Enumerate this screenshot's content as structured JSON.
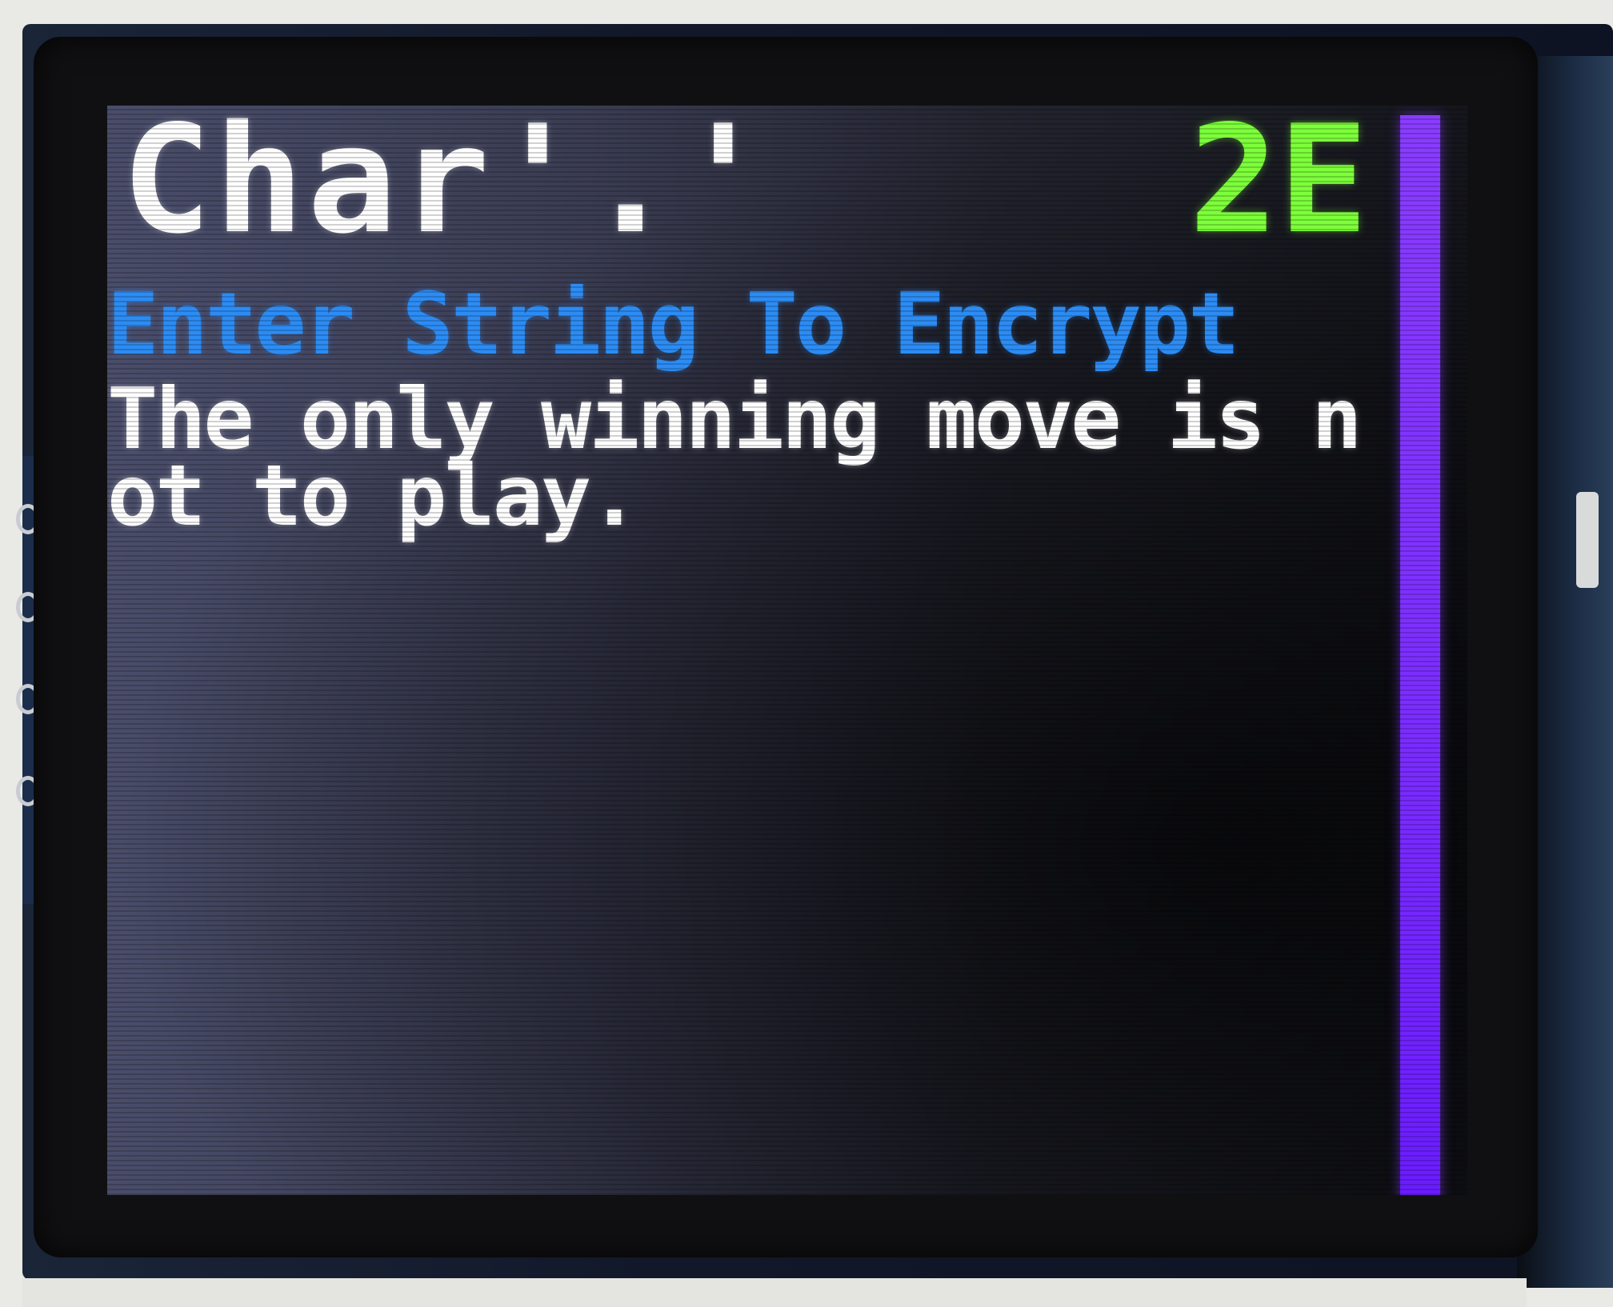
{
  "screen": {
    "title": "Char'.'",
    "hex_value": "2E",
    "prompt": "Enter String To Encrypt",
    "message_lines": [
      "The only winning move is n",
      "ot to play."
    ],
    "level_fraction": 1.0
  },
  "colors": {
    "title": "#ffffff",
    "hex_value": "#7dff3a",
    "prompt": "#2c8cf4",
    "message": "#ffffff",
    "level_bar": "#7a2cff"
  },
  "icons": {
    "header_pins": "header-pin-icon"
  }
}
